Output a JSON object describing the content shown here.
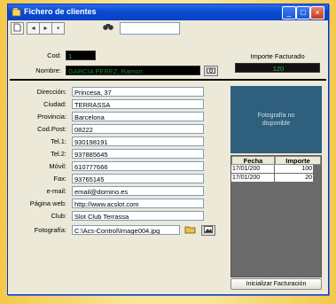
{
  "window": {
    "title": "Fichero de clientes"
  },
  "titlebar_buttons": [
    "_",
    "□",
    "×"
  ],
  "labels": {
    "cod": "Cod:",
    "nombre": "Nombre:",
    "importe": "Importe Facturado",
    "direccion": "Dirección:",
    "ciudad": "Ciudad:",
    "provincia": "Provincia:",
    "codpost": "Cod.Post:",
    "tel1": "Tel.1:",
    "tel2": "Tel.2:",
    "movil": "Móvil:",
    "fax": "Fax:",
    "email": "e-mail:",
    "web": "Página web:",
    "club": "Club:",
    "foto": "Fotografía:"
  },
  "values": {
    "cod": "1",
    "nombre": "GARCIA PEREZ, Ramon",
    "importe": "120",
    "direccion": "Princesa, 37",
    "ciudad": "TERRASSA",
    "provincia": "Barcelona",
    "codpost": "08222",
    "tel1": "930198191",
    "tel2": "937885645",
    "movil": "610777666",
    "fax": "93765145",
    "email": "email@domino.es",
    "web": "http://www.acslot.com",
    "club": "Slot Club Terrassa",
    "foto": "C:\\Acs-Control\\Image004.jpg"
  },
  "photo_placeholder": "Fotografía no disponible",
  "billing_table": {
    "headers": [
      "Fecha",
      "Importe"
    ],
    "rows": [
      [
        "17/01/200",
        "100"
      ],
      [
        "17/01/200",
        "20"
      ]
    ]
  },
  "reset_button": "Inicializar Facturación",
  "colors": {
    "titlebar": "#0a4ad0",
    "photo_bg": "#2e5f7d",
    "frame": "#f3c94a"
  }
}
